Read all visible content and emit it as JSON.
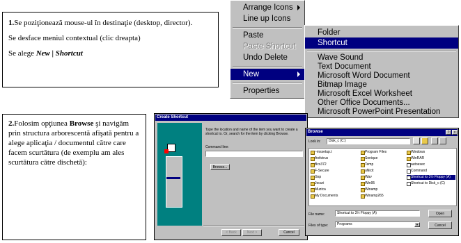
{
  "box1": {
    "line1_num": "1.",
    "line1_text": "Se poziţionează mouse-ul în destinaţie (desktop, director).",
    "line2": "Se desface meniul contextual (clic dreapta)",
    "line3_prefix": "Se alege ",
    "line3_bold": "New | Shortcut"
  },
  "box2": {
    "num": "2.",
    "t1": "Folosim opţiunea ",
    "bold": "Browse",
    "t2": " şi navigăm prin structura arborescentă afişată pentru a alege aplicaţia / documentul către care facem scurtătura (de exemplu am ales scurtătura către dischetă):"
  },
  "context_menu": {
    "items": [
      "Arrange Icons",
      "Line up Icons",
      "Paste",
      "Paste Shortcut",
      "Undo Delete",
      "New",
      "Properties"
    ]
  },
  "new_submenu": {
    "items": [
      "Folder",
      "Shortcut",
      "Wave Sound",
      "Text Document",
      "Microsoft Word Document",
      "Bitmap Image",
      "Microsoft Excel Worksheet",
      "Other Office Documents...",
      "Microsoft PowerPoint Presentation"
    ]
  },
  "create_shortcut": {
    "title": "Create Shortcut",
    "instructions": "Type the location and name of the item you want to create a shortcut to. Or, search for the item by clicking Browse.",
    "command_line_label": "Command line:",
    "browse_label": "Browse...",
    "back_label": "< Back",
    "next_label": "Next >",
    "cancel_label": "Cancel"
  },
  "browse_dialog": {
    "title": "Browse",
    "help": "?",
    "close": "×",
    "look_in_label": "Look in:",
    "look_in_value": "Disk_c (C:)",
    "col1": [
      "~mssetup.t",
      "Antivirus",
      "Bcs372",
      "F-Secure",
      "Gsp",
      "Jocuri",
      "Muzica",
      "My Documents"
    ],
    "col2": [
      "Program Files",
      "Sonique",
      "Temp",
      "uNicit",
      "Wav",
      "Win95",
      "Winamp",
      "Winamp265"
    ],
    "col3": [
      "Windows",
      "WinRAR",
      "autoexec",
      "Command",
      "Shortcut to 3½ Floppy (A)",
      "Shortcut to Disk_c (C)"
    ],
    "selected": "Shortcut to 3½ Floppy (A)",
    "file_name_label": "File name:",
    "file_name_value": "Shortcut to 3½ Floppy (A)",
    "files_of_type_label": "Files of type:",
    "files_of_type_value": "Programs",
    "open_label": "Open",
    "cancel_label": "Cancel"
  }
}
